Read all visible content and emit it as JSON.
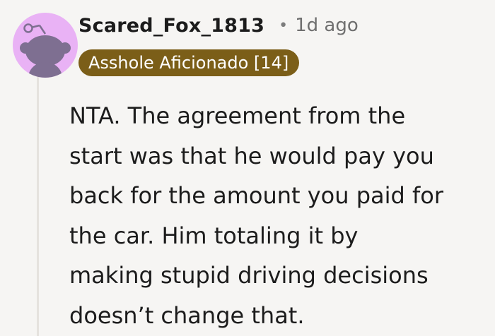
{
  "comment": {
    "author": "Scared_Fox_1813",
    "separator": "•",
    "time_ago": "1d ago",
    "flair": "Asshole Aficionado [14]",
    "body_lines": [
      "NTA. The agreement from the",
      "start was that he would pay you",
      "back for the amount you paid for",
      "the car. Him totaling it by",
      "making stupid driving decisions",
      "doesn’t change that."
    ]
  },
  "colors": {
    "background": "#f6f5f3",
    "avatar_background": "#e9b2f5",
    "avatar_figure": "#7e6f91",
    "flair_background": "#7b5e18",
    "flair_text": "#ffffff",
    "thread_line": "#e5e2de"
  },
  "icons": {
    "avatar": "reddit-snoo-avatar-icon"
  }
}
